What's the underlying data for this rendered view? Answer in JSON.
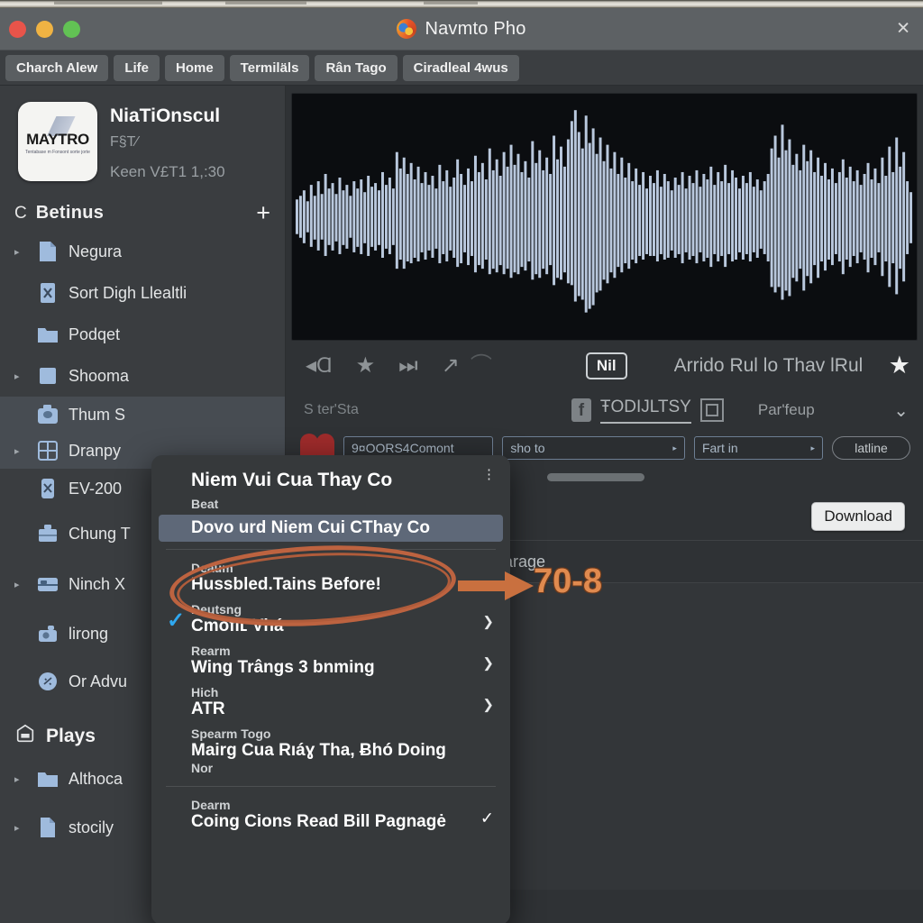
{
  "window": {
    "title": "Navmto Pho",
    "close_label": "✕",
    "app_icon": "firefox-icon"
  },
  "tabs": [
    {
      "label": "Charch Alew"
    },
    {
      "label": "Life"
    },
    {
      "label": "Home"
    },
    {
      "label": "Termiläls"
    },
    {
      "label": "Rân Tago"
    },
    {
      "label": "Ciradleal 4wus"
    }
  ],
  "sidebar": {
    "account": {
      "logo_word": "MAYTRO",
      "logo_sub": "Tentabase m Fonsont\nsorte jorte",
      "name": "NiaTiOnscul",
      "sub1": "F§T⁄",
      "sub2": "Keen V£T1 1,:30"
    },
    "section1": {
      "icon": "circle-c-icon",
      "icon_glyph": "C",
      "title": "Betinus",
      "add_label": "+"
    },
    "items": [
      {
        "label": "Negura",
        "icon": "document-icon",
        "caret": true,
        "selected": false
      },
      {
        "label": "Sort Digh Llealtli",
        "icon": "file-x-icon",
        "caret": false,
        "selected": false
      },
      {
        "label": "Podqet",
        "icon": "folder-icon",
        "caret": false,
        "selected": false
      },
      {
        "label": "Shooma",
        "icon": "square-icon",
        "caret": true,
        "selected": false
      },
      {
        "label": "Thum S",
        "icon": "camera-icon",
        "caret": false,
        "selected": true
      },
      {
        "label": "Dranpy",
        "icon": "grid-icon",
        "caret": true,
        "selected": true
      },
      {
        "label": "EV-200",
        "icon": "device-x-icon",
        "caret": false,
        "selected": false
      },
      {
        "label": "Chung T",
        "icon": "briefcase-icon",
        "caret": false,
        "selected": false
      },
      {
        "label": "Ninch X",
        "icon": "bed-icon",
        "caret": true,
        "selected": false
      },
      {
        "label": "lirong",
        "icon": "photo-camera-icon",
        "caret": false,
        "selected": false
      },
      {
        "label": "Or Advu",
        "icon": "badge-icon",
        "caret": false,
        "selected": false
      }
    ],
    "section2": {
      "icon": "home-pentagon-icon",
      "title": "Plays"
    },
    "items2": [
      {
        "label": "Althoca",
        "icon": "folder-icon",
        "caret": true
      },
      {
        "label": "stocily",
        "icon": "document-icon",
        "caret": true
      }
    ]
  },
  "player": {
    "controls": [
      {
        "name": "rewind-icon",
        "glyph": "◂Ɑ"
      },
      {
        "name": "star-icon",
        "glyph": "★"
      },
      {
        "name": "next-track-icon",
        "glyph": "⏭"
      },
      {
        "name": "share-arrow-icon",
        "glyph": "↗"
      },
      {
        "name": "curve-icon",
        "glyph": "⌒"
      }
    ],
    "badge": "Nil",
    "track_title": "Arrido Rul lo Thav lRul",
    "favorite_icon": "star-filled-icon",
    "meta_left": "S ter'Sta",
    "meta_facebook_glyph": "f",
    "meta_tag": "ŦODIJLTSY",
    "meta_frame_icon": "frame-icon",
    "meta_right": "Par'feup",
    "meta_chevron": "⌄"
  },
  "fields": {
    "heart_icon": "heart-icon",
    "comment_value": "9¤OORS4Comont",
    "select1_value": "sho to",
    "select2_value": "Fart in",
    "pill_value": "latline"
  },
  "download": {
    "label": "Download"
  },
  "table": {
    "col1_icon": "drop-icon",
    "col1_glyph": "○",
    "col2_header": "Hagnarage"
  },
  "menu": {
    "title": "Niem Vui Cua Thay Co",
    "dots": "⋮",
    "items": [
      {
        "sub": "Beat",
        "value": "Dovo urd Niem Cui CThay Co",
        "highlight": true,
        "check": false,
        "arrow": false,
        "tick": false
      },
      {
        "sub": "Deaum",
        "value": "Hussbled.Tains Before!",
        "highlight": false,
        "check": false,
        "arrow": false,
        "tick": false
      },
      {
        "sub": "Deutsng",
        "value": "Cmofiʟ Vhá",
        "highlight": false,
        "check": true,
        "arrow": true,
        "tick": false
      },
      {
        "sub": "Rearm",
        "value": "Wing Trângs 3 bnming",
        "highlight": false,
        "check": false,
        "arrow": true,
        "tick": false
      },
      {
        "sub": "Hiсh",
        "value": "ATR",
        "highlight": false,
        "check": false,
        "arrow": true,
        "tick": false
      },
      {
        "sub": "Spearm Togo",
        "value": "Mairg Cua Rıáɣ Tha, Ƀhó Doing",
        "sub2": "Nor",
        "highlight": false,
        "check": false,
        "arrow": false,
        "tick": false
      },
      {
        "sub": "Dearm",
        "value": "Coing Cions Read Bill Pagnagė",
        "highlight": false,
        "check": false,
        "arrow": false,
        "tick": true
      }
    ]
  },
  "annotation": {
    "number": "70-8",
    "color": "#c9703f"
  },
  "colors": {
    "accent_orange": "#c9703f",
    "waveform": "#b9c8dd",
    "highlight_blue": "#5e6878",
    "check_blue": "#2fa8f0"
  }
}
